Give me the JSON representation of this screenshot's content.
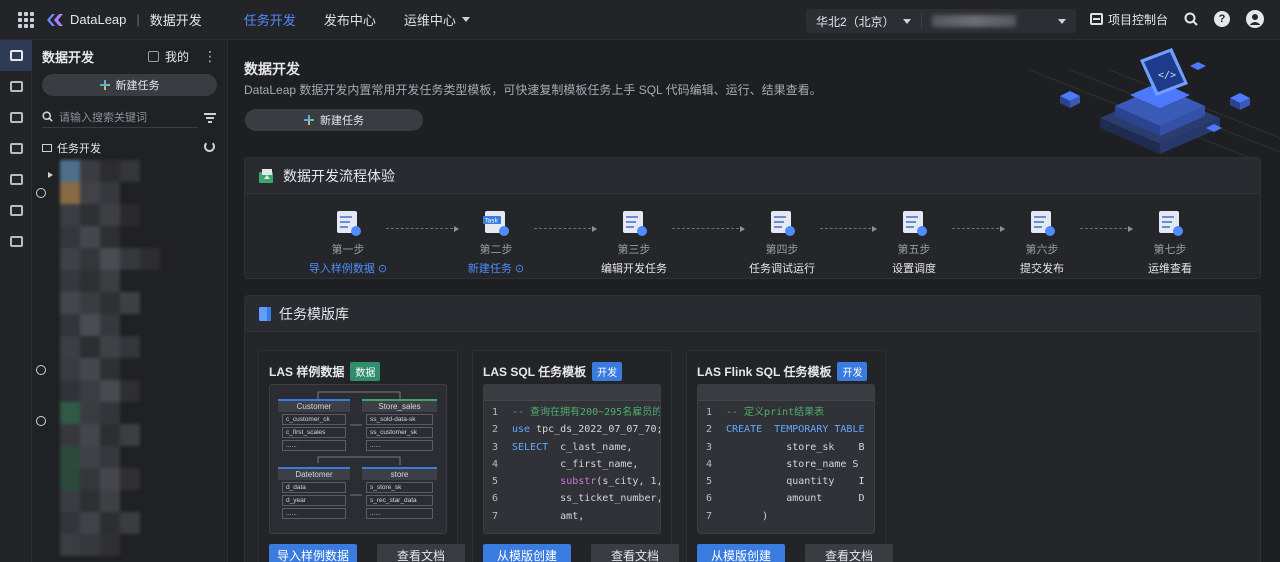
{
  "topbar": {
    "logo_text": "DataLeap",
    "module_text": "数据开发",
    "nav": [
      "任务开发",
      "发布中心",
      "运维中心"
    ],
    "region": "华北2（北京）",
    "console_label": "项目控制台"
  },
  "sidebar": {
    "title": "数据开发",
    "mine_label": "我的",
    "new_task_label": "新建任务",
    "search_placeholder": "请输入搜索关键词",
    "tree_root": "任务开发"
  },
  "hero": {
    "title": "数据开发",
    "description": "DataLeap 数据开发内置常用开发任务类型模板，可快速复制模板任务上手 SQL 代码编辑、运行、结果查看。",
    "new_task_label": "新建任务"
  },
  "flow": {
    "title": "数据开发流程体验",
    "steps": [
      {
        "num": "第一步",
        "label": "导入样例数据 ⊙",
        "link": true
      },
      {
        "num": "第二步",
        "label": "新建任务 ⊙",
        "link": true
      },
      {
        "num": "第三步",
        "label": "编辑开发任务",
        "link": false
      },
      {
        "num": "第四步",
        "label": "任务调试运行",
        "link": false
      },
      {
        "num": "第五步",
        "label": "设置调度",
        "link": false
      },
      {
        "num": "第六步",
        "label": "提交发布",
        "link": false
      },
      {
        "num": "第七步",
        "label": "运维查看",
        "link": false
      }
    ],
    "task_icon_text": "Task"
  },
  "library": {
    "title": "任务模版库",
    "templates": [
      {
        "name": "LAS 样例数据",
        "tag": "数据",
        "primary": "导入样例数据",
        "secondary": "查看文档",
        "er": {
          "tables": [
            {
              "name": "Customer",
              "fields": [
                "c_customer_ck",
                "c_first_scales",
                "......"
              ]
            },
            {
              "name": "Store_sales",
              "fields": [
                "ss_sold-data-sk",
                "ss_customer_sk",
                "......"
              ]
            },
            {
              "name": "Datetomer",
              "fields": [
                "d_data",
                "d_year",
                "......"
              ]
            },
            {
              "name": "store",
              "fields": [
                "s_store_sk",
                "s_rec_star_data",
                "......"
              ]
            }
          ]
        }
      },
      {
        "name": "LAS SQL 任务模板",
        "tag": "开发",
        "primary": "从模版创建",
        "secondary": "查看文档",
        "code": [
          "-- 查询在拥有200~295名雇员的",
          "use tpc_ds_2022_07_07_70;",
          "SELECT  c_last_name,",
          "        c_first_name,",
          "        substr(s_city, 1,",
          "        ss_ticket_number,",
          "        amt,"
        ]
      },
      {
        "name": "LAS Flink SQL 任务模板",
        "tag": "开发",
        "primary": "从模版创建",
        "secondary": "查看文档",
        "code": [
          "-- 定义print结果表",
          "CREATE  TEMPORARY TABLE",
          "          store_sk    B",
          "          store_name S",
          "          quantity    I",
          "          amount      D",
          "      )"
        ]
      }
    ]
  }
}
